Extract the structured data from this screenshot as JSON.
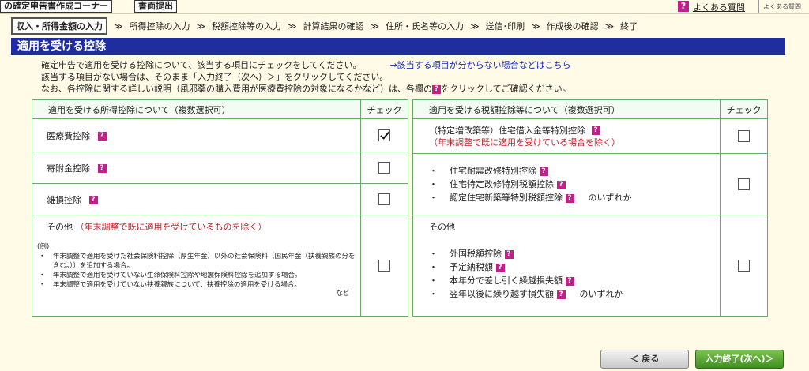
{
  "topbar": {
    "app_title": "の確定申告書作成コーナー",
    "print_label": "書面提出",
    "faq_icon": "?",
    "faq_label": "よくある質問",
    "faq_label_small": "よくある質問"
  },
  "steps": [
    "収入・所得金額の入力",
    "所得控除の入力",
    "税額控除等の入力",
    "計算結果の確認",
    "住所・氏名等の入力",
    "送信･印刷",
    "作成後の確認",
    "終了"
  ],
  "step_arrow": "≫",
  "section_title": "適用を受ける控除",
  "intro": {
    "line1": "確定申告で適用を受ける控除について、該当する項目にチェックをしてください。",
    "help_link": "→該当する項目が分からない場合などはこちら",
    "line2": "該当する項目がない場合は、そのまま「入力終了（次へ）＞」をクリックしてください。",
    "line3a": "なお、各控除に関する詳しい説明（風邪薬の購入費用が医療費控除の対象になるかなど）は、各欄の",
    "line3b": "をクリックしてご確認ください。"
  },
  "q_badge": "?",
  "income_table": {
    "header": "適用を受ける所得控除について（複数選択可）",
    "check_header": "チェック",
    "rows": [
      {
        "label": "医療費控除",
        "checked": true
      },
      {
        "label": "寄附金控除",
        "checked": false
      },
      {
        "label": "雑損控除",
        "checked": false
      }
    ],
    "other": {
      "label": "その他",
      "note": "（年末調整で既に適用を受けているものを除く）",
      "example_label": "(例)",
      "examples": [
        "年末調整で適用を受けた社会保険料控除（厚生年金）以外の社会保険料（国民年金（扶養親族の分を含む。））を追加する場合。",
        "年末調整で適用を受けていない生命保険料控除や地震保険料控除を追加する場合。",
        "年末調整で適用を受けていない扶養親族について、扶養控除の適用を受ける場合。"
      ],
      "suffix": "など",
      "checked": false
    }
  },
  "tax_table": {
    "header": "適用を受ける税額控除等について（複数選択可）",
    "check_header": "チェック",
    "housing_loan": {
      "label": "（特定増改築等）住宅借入金等特別控除",
      "note": "（年末調整で既に適用を受けている場合を除く）",
      "checked": false
    },
    "renovation": {
      "items": [
        "住宅耐震改修特別控除",
        "住宅特定改修特別税額控除",
        "認定住宅新築等特別税額控除"
      ],
      "suffix": "のいずれか",
      "checked": false
    },
    "other": {
      "label": "その他",
      "items": [
        "外国税額控除",
        "予定納税額",
        "本年分で差し引く繰越損失額",
        "翌年以後に繰り越す損失額"
      ],
      "suffix": "のいずれか",
      "checked": false
    }
  },
  "buttons": {
    "back": "＜ 戻る",
    "finish": "入力終了(次へ)＞"
  }
}
